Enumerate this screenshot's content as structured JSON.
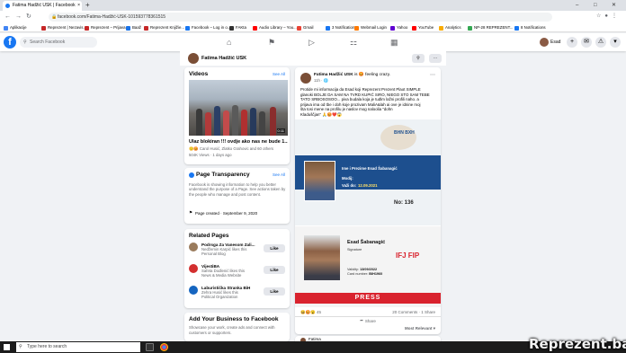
{
  "browser": {
    "tab_title": "Fatima Hadžić USK | Facebook",
    "tab_close": "×",
    "new_tab": "+",
    "url": "facebook.com/Fatima-Hadžić-USK-101593778361515",
    "bookmarks": [
      {
        "label": "Aplikacije",
        "color": "#4285f4"
      },
      {
        "label": "Reprezent | Nezavis...",
        "color": "#c62828"
      },
      {
        "label": "Reprezent – Prijava",
        "color": "#c62828"
      },
      {
        "label": "Baaž",
        "color": "#1a73e8"
      },
      {
        "label": "Reprezent Knjižie...",
        "color": "#c62828"
      },
      {
        "label": "Facebook – Log in o...",
        "color": "#1877f2"
      },
      {
        "label": "FAKta",
        "color": "#333333"
      },
      {
        "label": "Audio Library – You...",
        "color": "#ff0000"
      },
      {
        "label": "Gmail",
        "color": "#ea4335"
      },
      {
        "label": "3 Notifications",
        "color": "#1877f2"
      },
      {
        "label": "Webmail Login",
        "color": "#ff7a00"
      },
      {
        "label": "Yahoo",
        "color": "#6001d2"
      },
      {
        "label": "YouTube",
        "color": "#ff0000"
      },
      {
        "label": "Analytics",
        "color": "#f9ab00"
      },
      {
        "label": "NP-28 REPREZENT...",
        "color": "#34a853"
      },
      {
        "label": "8 Notifications",
        "color": "#1877f2"
      }
    ]
  },
  "facebook": {
    "logo": "f",
    "search_placeholder": "Search Facebook",
    "profile_name": "Esad"
  },
  "page_header": {
    "name": "Fatima Hadžić USK"
  },
  "videos": {
    "title": "Videos",
    "see_all": "See All",
    "duration": "0:11",
    "caption": "Ulaz blokiran !!! ovdje ako nas ne bude 1...",
    "reactions": "Carol Husić, Zlatko Grahovic and 60 others",
    "meta": "504K Views · 1 days ago"
  },
  "transparency": {
    "title": "Page Transparency",
    "see_all": "See All",
    "body": "Facebook is showing information to help you better understand the purpose of a Page. See actions taken by the people who manage and post content.",
    "created": "Page created · September 9, 2020"
  },
  "related": {
    "title": "Related Pages",
    "like": "Like",
    "items": [
      {
        "name": "Podrsga Za Vanesom Zali...",
        "sub1": "Nedžemin Karpić likes this",
        "sub2": "Personal Blog",
        "color": "#9a7b5c"
      },
      {
        "name": "VijestiBA",
        "sub1": "Safeta Dodlenić likes this",
        "sub2": "News & Media Website",
        "color": "#d32f2f"
      },
      {
        "name": "Laburistička Stranka BiH",
        "sub1": "Zehra Husić likes this",
        "sub2": "Political Organization",
        "color": "#1565c0"
      }
    ]
  },
  "business": {
    "title": "Add Your Business to Facebook",
    "body": "Showcase your work, create ads and connect with customers or supporters."
  },
  "post": {
    "author": "Fatima Hadžić USK",
    "feeling": "is 😡 feeling crazy.",
    "time": "11h · 🌐",
    "text": "Protide mi informacija da Esad koji Reprezent Prezent Plaot SIMPLE\nglanoki BOLJE DA SAM NA TVRD KUPIĆ SIRO, NIEGO STO SAM TEBE\nTATO SRBOSOSOO... piva budala koja je tuđim lažni profili naho. a\nprijava ima od tbe i doh koje prozivam MaliA&lah ai ove je idnine moj\nšta tosi mene na profilu je naslov mog naloolia \"dohn\nKladuščjan\" 🙏😡❤️😱",
    "card1": {
      "brand": "BHN BXH",
      "label_name": "Ime i Prezime Esad Šabanagić",
      "label_role": "Modij:",
      "label_valid": "Važi do:",
      "valid_date": "12.09.2021",
      "number": "No: 136"
    },
    "card2": {
      "name": "Esad Šabanagić",
      "sig_label": "Signature",
      "validity_label": "Validity:",
      "validity": "13/09/2022",
      "cardno_label": "Card number:",
      "cardno": "BIH1960",
      "org": "IFJ FIP",
      "press": "PRESS"
    },
    "reactions": "😆😡😮 45",
    "comments": "20 Comments · 1 Share",
    "share": "Share",
    "most_relevant": "Most Relevant ▾",
    "next_post": "Fatima"
  },
  "taskbar": {
    "search_placeholder": "Type here to search"
  },
  "watermark": "Reprezent.ba"
}
